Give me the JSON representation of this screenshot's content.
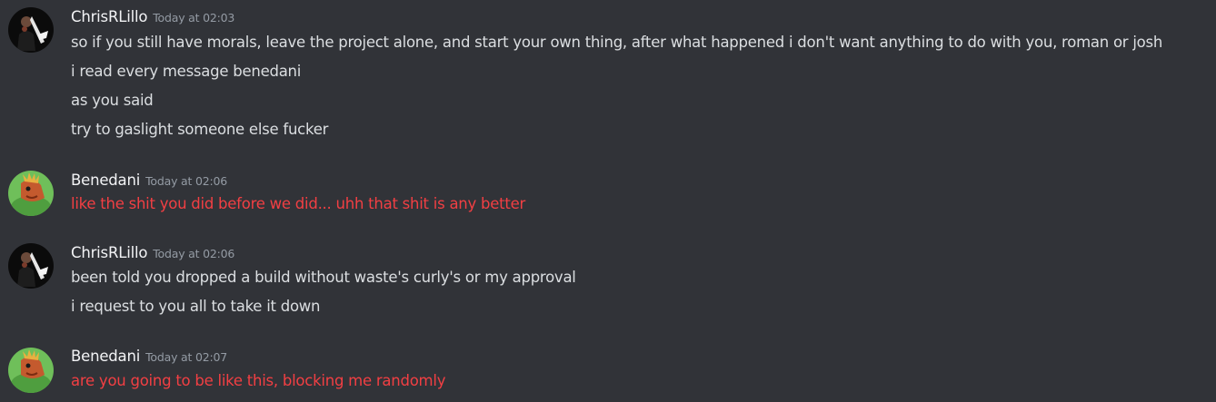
{
  "messages": [
    {
      "author": "ChrisRLillo",
      "timestamp": "Today at 02:03",
      "lines": [
        "so if you still have morals, leave the project alone, and start your own thing, after what happened i don't want anything to do with you, roman or josh",
        "i read every message benedani",
        "as you said",
        "try to gaslight someone else fucker"
      ]
    },
    {
      "author": "Benedani",
      "timestamp": "Today at 02:06",
      "lines": [
        "like the shit you did before we did... uhh that shit is any better"
      ]
    },
    {
      "author": "ChrisRLillo",
      "timestamp": "Today at 02:06",
      "lines": [
        "been told you dropped a build without waste's curly's or my approval",
        "i request to you all to take it down"
      ]
    },
    {
      "author": "Benedani",
      "timestamp": "Today at 02:07",
      "lines": [
        "are you going to be like this, blocking me randomly"
      ]
    }
  ],
  "colors": {
    "background": "#313338",
    "username": "#f2f3f5",
    "timestamp": "#949ba4",
    "text": "#dbdee1",
    "error_text": "#f23f43"
  }
}
